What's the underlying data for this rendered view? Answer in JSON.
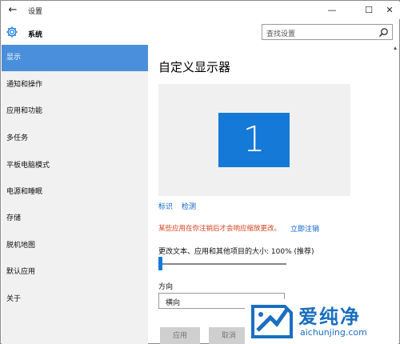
{
  "window": {
    "title": "设置",
    "back": "←",
    "minimize": "—",
    "maximize": "☐",
    "close": "✕"
  },
  "header": {
    "section": "系统"
  },
  "search": {
    "placeholder": "查找设置"
  },
  "sidebar": {
    "items": [
      {
        "label": "显示",
        "active": true
      },
      {
        "label": "通知和操作"
      },
      {
        "label": "应用和功能"
      },
      {
        "label": "多任务"
      },
      {
        "label": "平板电脑模式"
      },
      {
        "label": "电源和睡眠"
      },
      {
        "label": "存储"
      },
      {
        "label": "脱机地图"
      },
      {
        "label": "默认应用"
      },
      {
        "label": "关于"
      }
    ]
  },
  "main": {
    "title": "自定义显示器",
    "monitor_number": "1",
    "identify_link": "标识",
    "detect_link": "检测",
    "warning": "某些应用在你注销后才会响应缩放更改。",
    "signout_link": "立即注销",
    "scale_label": "更改文本、应用和其他项目的大小: 100% (推荐)",
    "scale_percent": 0,
    "orientation_label": "方向",
    "orientation_value": "横向",
    "apply_button": "应用",
    "cancel_button": "取消"
  },
  "watermark": {
    "cn": "爱纯净",
    "en": "aichunjing.com"
  },
  "colors": {
    "accent": "#1479d7",
    "nav_active": "#4a8fdc",
    "warning": "#d4421f",
    "link": "#0a63c9"
  }
}
